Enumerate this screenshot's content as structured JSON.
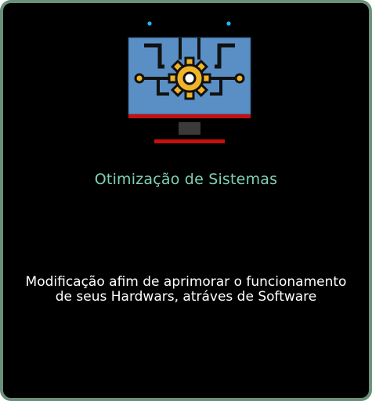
{
  "card": {
    "title": "Otimização de Sistemas",
    "description": "Modificação afim de aprimorar o funcionamento de seus Hardwars, atráves de Software",
    "icon": "monitor-gear-icon",
    "colors": {
      "background": "#000000",
      "border": "#6a8f7b",
      "title": "#7fd1b2",
      "screen": "#5a8fc5",
      "gear": "#f0b429",
      "stand": "#c61010"
    }
  }
}
